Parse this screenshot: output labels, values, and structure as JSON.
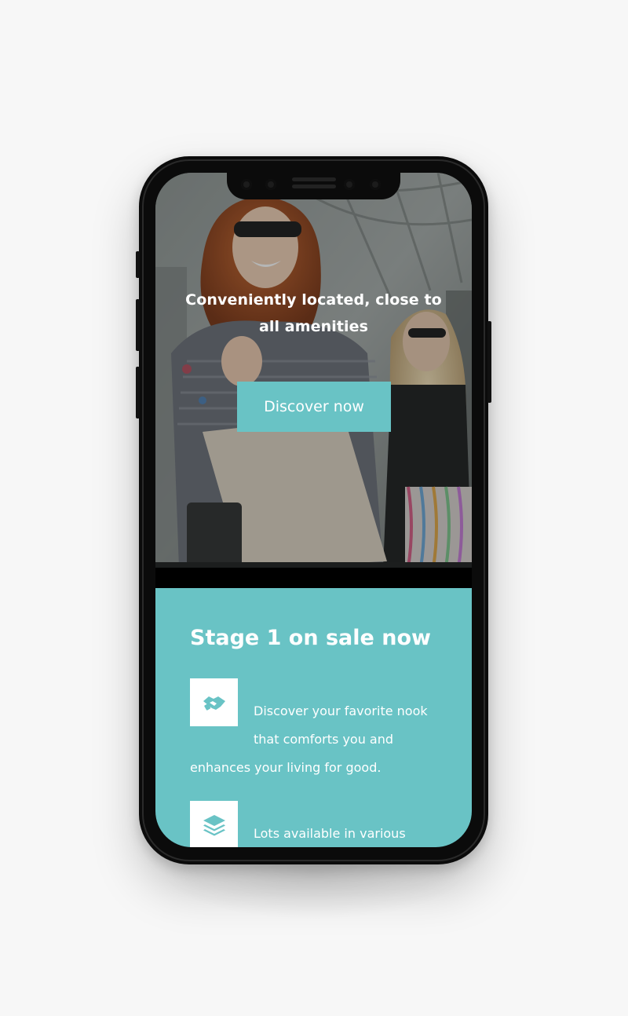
{
  "hero": {
    "title": "Conveniently located, close to all amenities",
    "cta_label": "Discover now"
  },
  "info": {
    "heading": "Stage 1 on sale now",
    "features": [
      {
        "icon": "handshake-icon",
        "text": "Discover your favorite nook that comforts you and enhances your living for good."
      },
      {
        "icon": "layers-icon",
        "text": "Lots available in various"
      }
    ]
  },
  "colors": {
    "accent": "#69c3c5",
    "page_background": "#f7f7f7",
    "device": "#0b0b0b",
    "text_on_accent": "#ffffff"
  }
}
